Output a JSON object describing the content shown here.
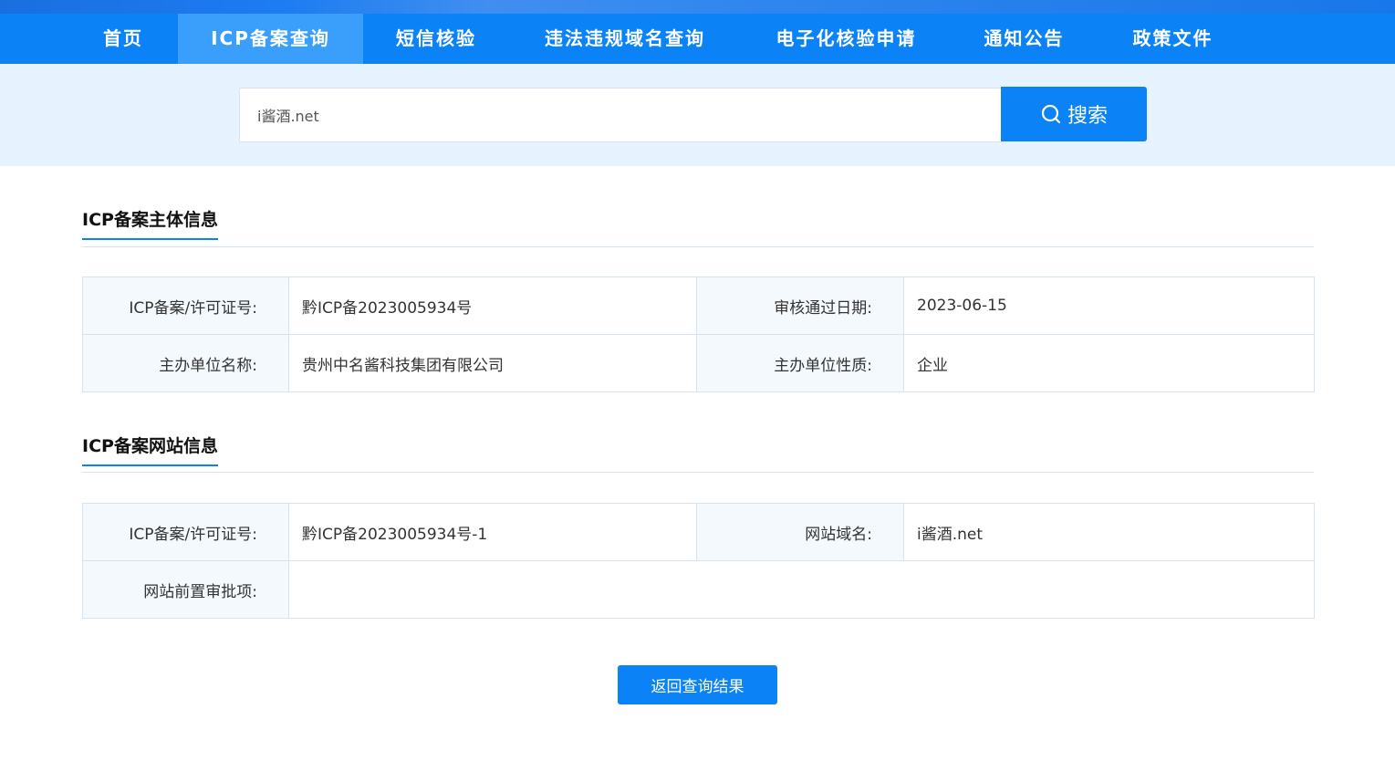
{
  "nav": {
    "items": [
      {
        "label": "首页"
      },
      {
        "label": "ICP备案查询"
      },
      {
        "label": "短信核验"
      },
      {
        "label": "违法违规域名查询"
      },
      {
        "label": "电子化核验申请"
      },
      {
        "label": "通知公告"
      },
      {
        "label": "政策文件"
      }
    ],
    "active": "ICP备案查询"
  },
  "search": {
    "value": "i酱酒.net",
    "button_label": "搜索",
    "button_icon": "search-icon"
  },
  "subject_section": {
    "title": "ICP备案主体信息",
    "rows": [
      {
        "label1": "ICP备案/许可证号:",
        "value1": "黔ICP备2023005934号",
        "label2": "审核通过日期:",
        "value2": "2023-06-15"
      },
      {
        "label1": "主办单位名称:",
        "value1": "贵州中名酱科技集团有限公司",
        "label2": "主办单位性质:",
        "value2": "企业"
      }
    ]
  },
  "website_section": {
    "title": "ICP备案网站信息",
    "license_label": "ICP备案/许可证号:",
    "license_value": "黔ICP备2023005934号-1",
    "domain_label": "网站域名:",
    "domain_value": "i酱酒.net",
    "approval_label": "网站前置审批项:",
    "approval_value": ""
  },
  "back_button": {
    "label": "返回查询结果"
  },
  "colors": {
    "primary": "#0b82f6",
    "nav_active": "#3a9ffb",
    "search_band": "#e6f2fd",
    "label_cell": "#f4f9fd",
    "border": "#d7e3ef"
  }
}
